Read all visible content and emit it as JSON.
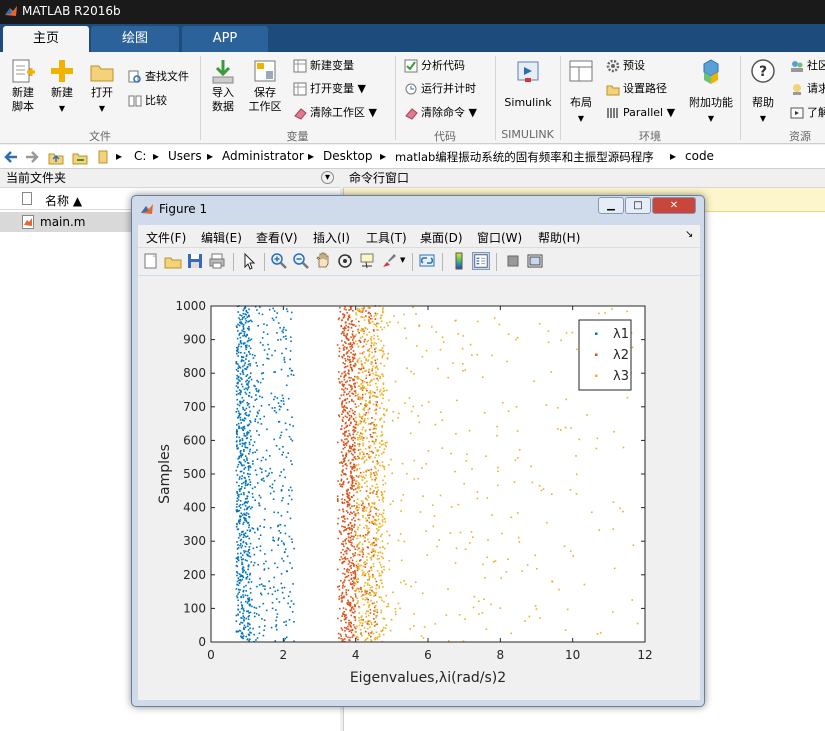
{
  "app": {
    "title": "MATLAB R2016b"
  },
  "tabs": [
    "主页",
    "绘图",
    "APP"
  ],
  "ribbon": {
    "new_script": [
      "新建",
      "脚本"
    ],
    "new": "新建",
    "open": "打开",
    "find_files": "查找文件",
    "compare": "比较",
    "import": [
      "导入",
      "数据"
    ],
    "save_ws": [
      "保存",
      "工作区"
    ],
    "new_var": "新建变量",
    "open_var": "打开变量",
    "clear_ws": "清除工作区",
    "analyze": "分析代码",
    "run_time": "运行并计时",
    "clear_cmd": "清除命令",
    "simulink": "Simulink",
    "layout": "布局",
    "prefs": "预设",
    "set_path": "设置路径",
    "parallel": "Parallel",
    "addons": "附加功能",
    "help": "帮助",
    "community": "社区",
    "request": "请求",
    "learn": "了解",
    "groups": [
      "文件",
      "变量",
      "代码",
      "SIMULINK",
      "环境",
      "资源"
    ]
  },
  "address": {
    "crumbs": [
      "C:",
      "Users",
      "Administrator",
      "Desktop",
      "matlab编程振动系统的固有频率和主振型源码程序",
      "code"
    ]
  },
  "file_panel": {
    "title": "当前文件夹",
    "col_name": "名称 ▲",
    "files": [
      "main.m"
    ]
  },
  "cmd_panel": {
    "title": "命令行窗口"
  },
  "figure": {
    "title": "Figure 1",
    "menus": [
      "文件(F)",
      "编辑(E)",
      "查看(V)",
      "插入(I)",
      "工具(T)",
      "桌面(D)",
      "窗口(W)",
      "帮助(H)"
    ]
  },
  "chart_data": {
    "type": "scatter",
    "xlabel": "Eigenvalues,λi(rad/s)2",
    "ylabel": "Samples",
    "xlim": [
      0,
      12
    ],
    "ylim": [
      0,
      1000
    ],
    "xticks": [
      0,
      2,
      4,
      6,
      8,
      10,
      12
    ],
    "yticks": [
      0,
      100,
      200,
      300,
      400,
      500,
      600,
      700,
      800,
      900,
      1000
    ],
    "grid": false,
    "legend_position": "top-right",
    "n_samples": 1000,
    "series": [
      {
        "name": "λ1",
        "color": "#0072bd",
        "x_range": [
          0.7,
          2.3
        ],
        "dense_range": [
          0.7,
          1.1
        ]
      },
      {
        "name": "λ2",
        "color": "#d95319",
        "x_range": [
          3.5,
          4.6
        ],
        "dense_range": [
          3.6,
          4.0
        ]
      },
      {
        "name": "λ3",
        "color": "#edb120",
        "x_range": [
          3.8,
          11.8
        ],
        "dense_range": [
          4.0,
          4.8
        ]
      }
    ]
  }
}
